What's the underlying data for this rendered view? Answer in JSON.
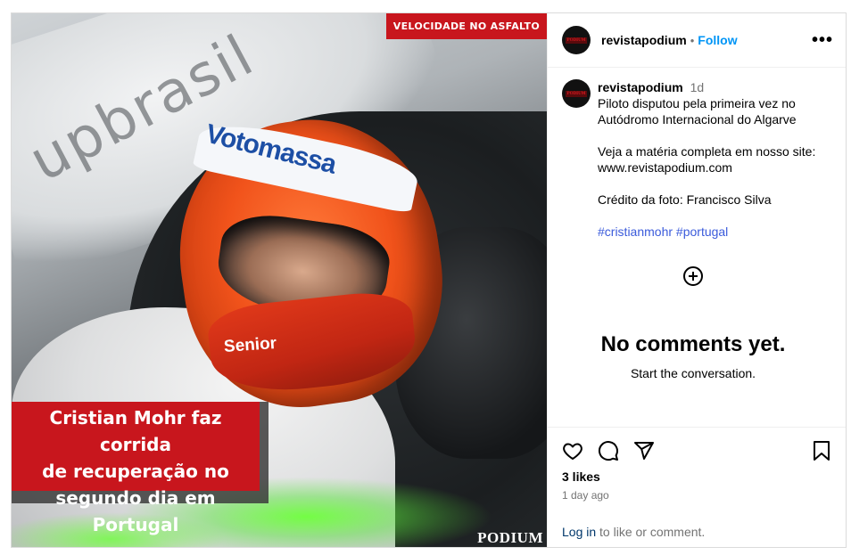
{
  "image": {
    "tag": "VELOCIDADE NO ASFALTO",
    "headline_lines": [
      "Cristian Mohr faz corrida",
      "de recuperação no",
      "segundo dia em Portugal"
    ],
    "brand": "PODIUM",
    "helmet_text": "Votomassa",
    "chin_text": "Senior"
  },
  "header": {
    "avatar_text": "PODIUM",
    "username": "revistapodium",
    "separator": "•",
    "follow_label": "Follow",
    "more_label": "•••"
  },
  "caption": {
    "username": "revistapodium",
    "time": "1d",
    "line1": "Piloto disputou pela primeira vez no Autódromo Internacional do Algarve",
    "line2": "Veja a matéria completa em nosso site: www.revistapodium.com",
    "line3": "Crédito da foto: Francisco Silva",
    "hashtags": "#cristianmohr #portugal"
  },
  "comments": {
    "empty_title": "No comments yet.",
    "empty_sub": "Start the conversation."
  },
  "footer": {
    "likes": "3 likes",
    "ago": "1 day ago",
    "login_link": "Log in",
    "login_rest": " to like or comment."
  }
}
